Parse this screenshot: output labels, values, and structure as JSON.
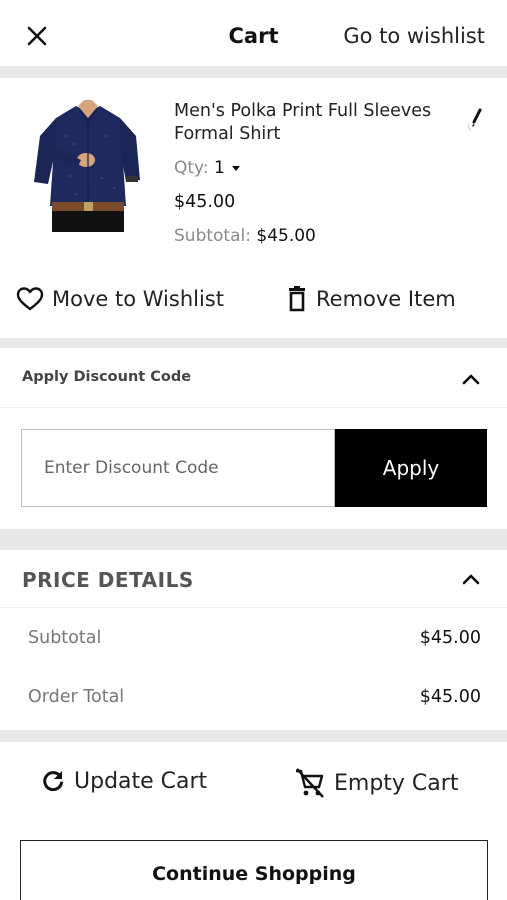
{
  "header": {
    "close_icon": "close-icon",
    "title": "Cart",
    "wishlist_link": "Go to wishlist"
  },
  "product": {
    "name": "Men's Polka Print Full Sleeves Formal Shirt",
    "qty_label": "Qty:",
    "qty_value": "1",
    "price": "$45.00",
    "subtotal_label": "Subtotal:",
    "subtotal_value": "$45.00",
    "image": "navy-polka-shirt",
    "edit_icon": "pencil-icon"
  },
  "actions": {
    "move_to_wishlist": "Move to Wishlist",
    "remove_item": "Remove Item"
  },
  "discount": {
    "title": "Apply Discount Code",
    "placeholder": "Enter Discount Code",
    "apply_label": "Apply"
  },
  "price_details": {
    "title": "PRICE DETAILS",
    "rows": [
      {
        "label": "Subtotal",
        "value": "$45.00"
      },
      {
        "label": "Order Total",
        "value": "$45.00"
      }
    ]
  },
  "bottom": {
    "update_cart": "Update Cart",
    "empty_cart": "Empty Cart",
    "continue_shopping": "Continue Shopping"
  },
  "colors": {
    "divider": "#e8e8e8",
    "apply_bg": "#000000",
    "shirt": "#1e2a5e"
  }
}
